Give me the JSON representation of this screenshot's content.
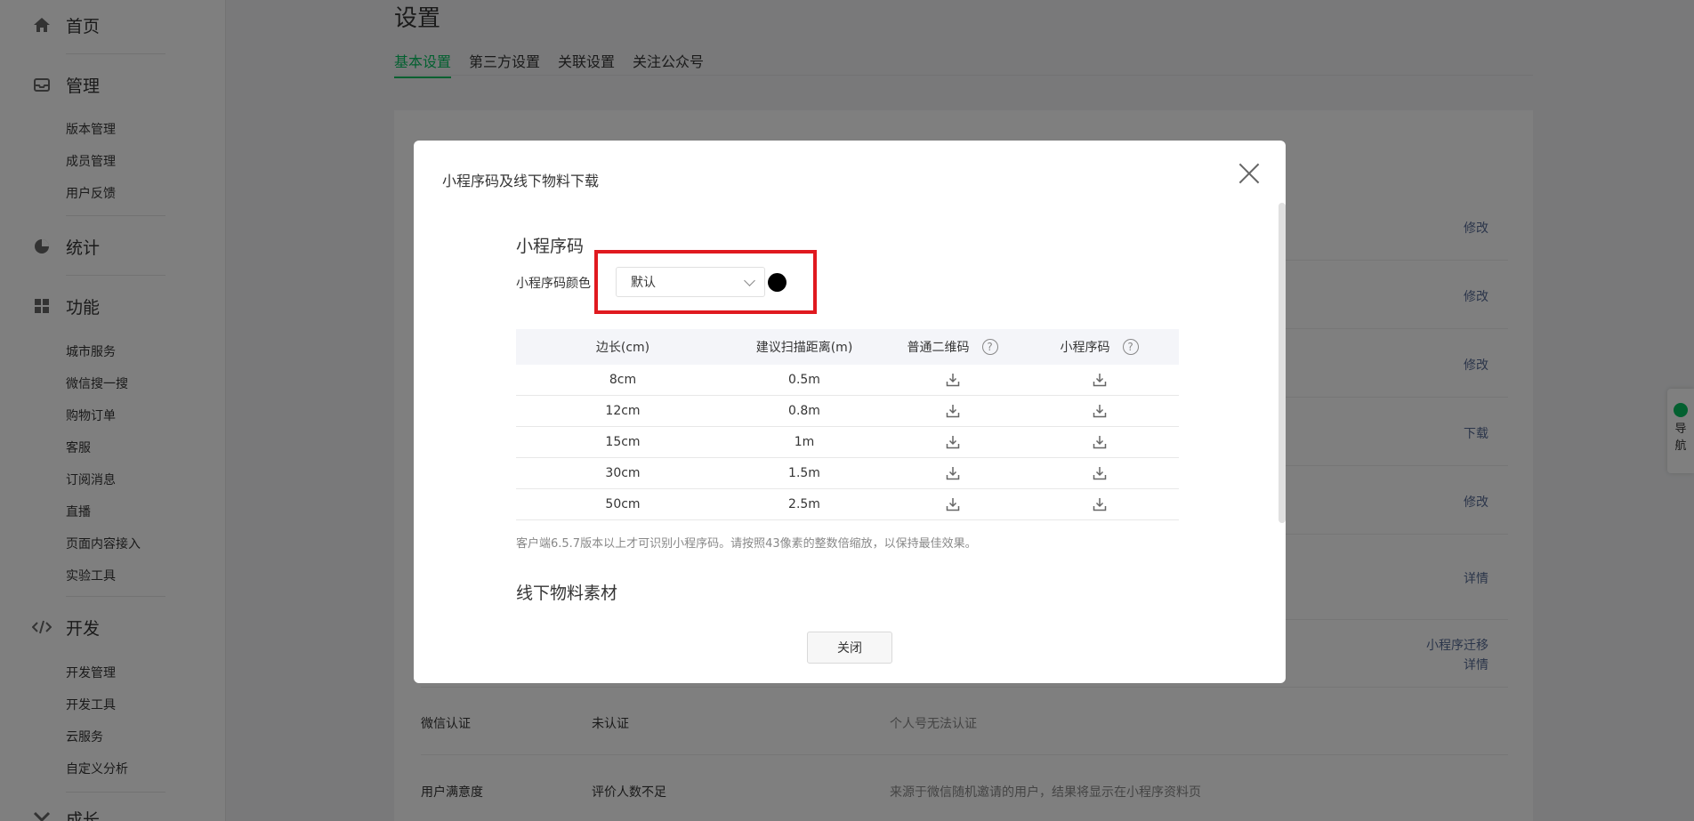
{
  "sidebar": {
    "home": "首页",
    "manage": {
      "label": "管理",
      "items": [
        "版本管理",
        "成员管理",
        "用户反馈"
      ]
    },
    "stats": "统计",
    "features": {
      "label": "功能",
      "items": [
        "城市服务",
        "微信搜一搜",
        "购物订单",
        "客服",
        "订阅消息",
        "直播",
        "页面内容接入",
        "实验工具"
      ]
    },
    "dev": {
      "label": "开发",
      "items": [
        "开发管理",
        "开发工具",
        "云服务",
        "自定义分析"
      ]
    },
    "growth": "成长"
  },
  "main": {
    "title": "设置",
    "tabs": [
      "基本设置",
      "第三方设置",
      "关联设置",
      "关注公众号"
    ],
    "row_links": [
      "修改",
      "修改",
      "修改",
      "下载",
      "修改",
      "详情",
      "小程序迁移",
      "详情"
    ],
    "info_rows": [
      {
        "label": "微信认证",
        "value": "未认证",
        "desc": "个人号无法认证"
      },
      {
        "label": "用户满意度",
        "value": "评价人数不足",
        "desc": "来源于微信随机邀请的用户，结果将显示在小程序资料页"
      }
    ]
  },
  "float_nav": {
    "line1": "导",
    "line2": "航"
  },
  "modal": {
    "title": "小程序码及线下物料下载",
    "section1": "小程序码",
    "color_label": "小程序码颜色",
    "color_select": "默认",
    "color_value": "#000000",
    "table": {
      "headers": [
        "边长(cm)",
        "建议扫描距离(m)",
        "普通二维码",
        "小程序码"
      ],
      "help_glyph": "?",
      "rows": [
        [
          "8cm",
          "0.5m"
        ],
        [
          "12cm",
          "0.8m"
        ],
        [
          "15cm",
          "1m"
        ],
        [
          "30cm",
          "1.5m"
        ],
        [
          "50cm",
          "2.5m"
        ]
      ]
    },
    "note": "客户端6.5.7版本以上才可识别小程序码。请按照43像素的整数倍缩放，以保持最佳效果。",
    "section2": "线下物料素材",
    "close_button": "关闭"
  },
  "colors": {
    "accent": "#07c160",
    "link": "#576b95",
    "highlight": "#e0191f"
  }
}
